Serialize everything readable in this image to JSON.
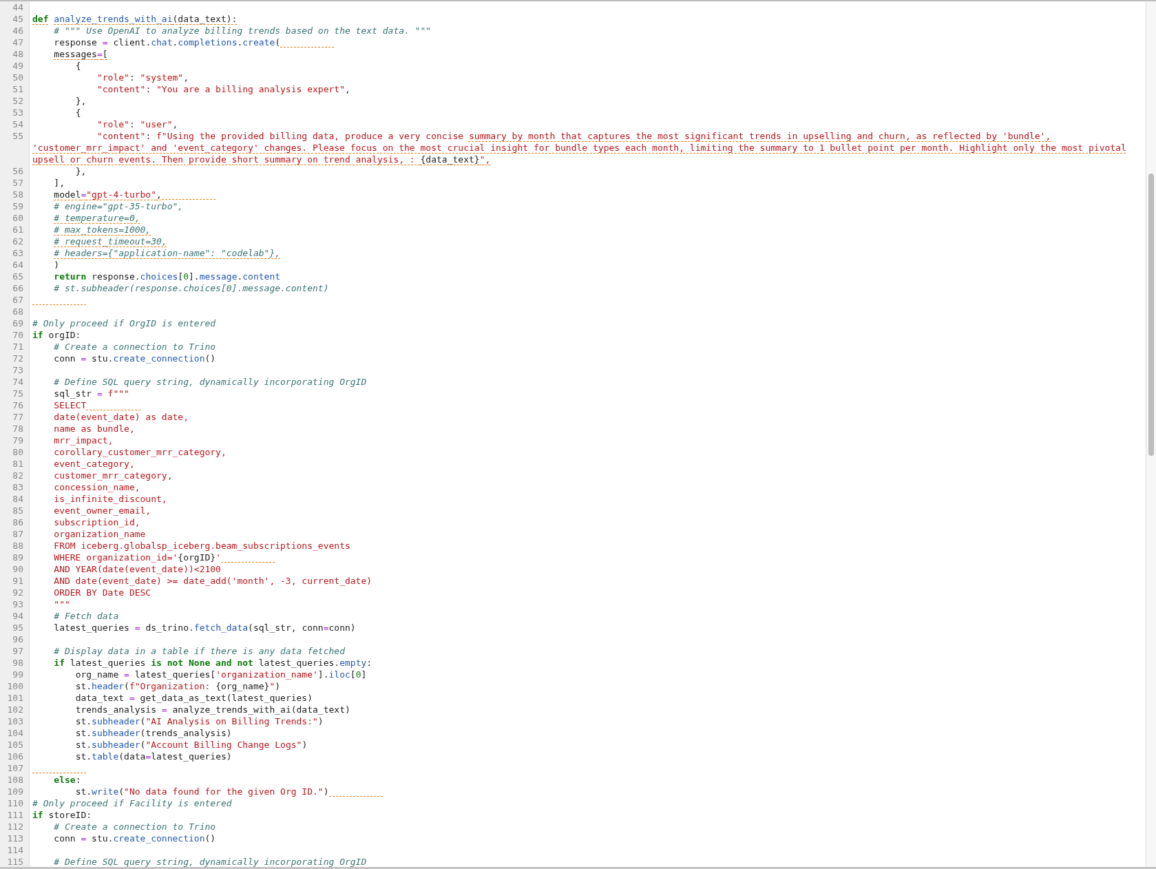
{
  "editor": {
    "lines": [
      {
        "number": "44"
      },
      {
        "number": "45",
        "tokens": [
          {
            "kind": "k",
            "text": "def",
            "warning": true
          },
          {
            "kind": "f",
            "text": " analyze_trends_with_ai",
            "warning": true
          },
          {
            "kind": "p",
            "text": "(data_text):",
            "warning": true
          }
        ]
      },
      {
        "number": "46",
        "tokens": [
          {
            "kind": "c",
            "text": "    # \"\"\" Use OpenAI to analyze billing trends based on the text data. \"\"\""
          }
        ]
      },
      {
        "number": "47",
        "trailing_warning": true,
        "tokens": [
          {
            "kind": "p",
            "text": "    response "
          },
          {
            "kind": "o",
            "text": "="
          },
          {
            "kind": "p",
            "text": " client."
          },
          {
            "kind": "f",
            "text": "chat"
          },
          {
            "kind": "p",
            "text": "."
          },
          {
            "kind": "f",
            "text": "completions"
          },
          {
            "kind": "p",
            "text": "."
          },
          {
            "kind": "f",
            "text": "create"
          },
          {
            "kind": "p",
            "text": "("
          }
        ]
      },
      {
        "number": "48",
        "tokens": [
          {
            "kind": "p",
            "text": "    messages",
            "warning": true
          },
          {
            "kind": "o",
            "text": "=",
            "warning": true
          },
          {
            "kind": "p",
            "text": "[",
            "warning": true
          }
        ]
      },
      {
        "number": "49",
        "tokens": [
          {
            "kind": "p",
            "text": "        {"
          }
        ]
      },
      {
        "number": "50",
        "tokens": [
          {
            "kind": "s",
            "text": "            \"role\""
          },
          {
            "kind": "p",
            "text": ": "
          },
          {
            "kind": "s",
            "text": "\"system\""
          },
          {
            "kind": "p",
            "text": ","
          }
        ]
      },
      {
        "number": "51",
        "tokens": [
          {
            "kind": "s",
            "text": "            \"content\""
          },
          {
            "kind": "p",
            "text": ": "
          },
          {
            "kind": "s",
            "text": "\"You are a billing analysis expert\""
          },
          {
            "kind": "p",
            "text": ","
          }
        ]
      },
      {
        "number": "52",
        "tokens": [
          {
            "kind": "p",
            "text": "        },"
          }
        ]
      },
      {
        "number": "53",
        "tokens": [
          {
            "kind": "p",
            "text": "        {"
          }
        ]
      },
      {
        "number": "54",
        "tokens": [
          {
            "kind": "s",
            "text": "            \"role\""
          },
          {
            "kind": "p",
            "text": ": "
          },
          {
            "kind": "s",
            "text": "\"user\""
          },
          {
            "kind": "p",
            "text": ","
          }
        ]
      },
      {
        "number": "55",
        "tokens": [
          {
            "kind": "s",
            "text": "            \"content\""
          },
          {
            "kind": "p",
            "text": ": "
          },
          {
            "kind": "s",
            "text": "f\"Using the provided billing data, produce a very concise"
          },
          {
            "kind": "s",
            "text": " summary by month that captures the most significant trends in upselling and churn, as reflected by 'bundle',",
            "warning": true
          }
        ],
        "continuation": [
          [
            {
              "kind": "s",
              "text": "'customer_mrr_impact' and 'event_category' changes. Please focus on the most crucial insight for bundle types each month, limiting the summary to 1 bullet point per month. Highlight only the most pivotal",
              "warning": true
            }
          ],
          [
            {
              "kind": "s",
              "text": "upsell or churn events. Then provide short summary on trend analysis, : ",
              "warning": true
            },
            {
              "kind": "p",
              "text": "{data_text}",
              "warning": true
            },
            {
              "kind": "s",
              "text": "\",",
              "warning": true
            }
          ]
        ]
      },
      {
        "number": "56",
        "tokens": [
          {
            "kind": "p",
            "text": "        },"
          }
        ]
      },
      {
        "number": "57",
        "tokens": [
          {
            "kind": "p",
            "text": "    ],"
          }
        ]
      },
      {
        "number": "58",
        "trailing_warning": true,
        "tokens": [
          {
            "kind": "p",
            "text": "    model",
            "warning": true
          },
          {
            "kind": "o",
            "text": "=",
            "warning": true
          },
          {
            "kind": "s",
            "text": "\"gpt-4-turbo\"",
            "warning": true
          },
          {
            "kind": "p",
            "text": ",",
            "warning": true
          }
        ]
      },
      {
        "number": "59",
        "tokens": [
          {
            "kind": "c",
            "text": "    # engine=\"gpt-35-turbo\","
          }
        ]
      },
      {
        "number": "60",
        "tokens": [
          {
            "kind": "c",
            "text": "    # temperature=0,",
            "warning": true
          }
        ]
      },
      {
        "number": "61",
        "tokens": [
          {
            "kind": "c",
            "text": "    # max_tokens=1000,",
            "warning": true
          }
        ]
      },
      {
        "number": "62",
        "tokens": [
          {
            "kind": "c",
            "text": "    # request_timeout=30,",
            "warning": true
          }
        ]
      },
      {
        "number": "63",
        "tokens": [
          {
            "kind": "c",
            "text": "    # headers={\"application-name\": \"codelab\"},",
            "warning": true
          }
        ]
      },
      {
        "number": "64",
        "tokens": [
          {
            "kind": "p",
            "text": "    )"
          }
        ]
      },
      {
        "number": "65",
        "tokens": [
          {
            "kind": "k",
            "text": "    return"
          },
          {
            "kind": "p",
            "text": " response."
          },
          {
            "kind": "f",
            "text": "choices"
          },
          {
            "kind": "p",
            "text": "["
          },
          {
            "kind": "n",
            "text": "0"
          },
          {
            "kind": "p",
            "text": "]."
          },
          {
            "kind": "f",
            "text": "message"
          },
          {
            "kind": "p",
            "text": "."
          },
          {
            "kind": "f",
            "text": "content"
          }
        ]
      },
      {
        "number": "66",
        "tokens": [
          {
            "kind": "c",
            "text": "    # st.subheader(response.choices[0].message.content)"
          }
        ]
      },
      {
        "number": "67",
        "trailing_warning": true
      },
      {
        "number": "68"
      },
      {
        "number": "69",
        "tokens": [
          {
            "kind": "c",
            "text": "# Only proceed if OrgID is entered"
          }
        ]
      },
      {
        "number": "70",
        "tokens": [
          {
            "kind": "k",
            "text": "if"
          },
          {
            "kind": "p",
            "text": " orgID:"
          }
        ]
      },
      {
        "number": "71",
        "tokens": [
          {
            "kind": "c",
            "text": "    # Create a connection to Trino"
          }
        ]
      },
      {
        "number": "72",
        "tokens": [
          {
            "kind": "p",
            "text": "    conn "
          },
          {
            "kind": "o",
            "text": "="
          },
          {
            "kind": "p",
            "text": " stu."
          },
          {
            "kind": "f",
            "text": "create_connection"
          },
          {
            "kind": "p",
            "text": "()"
          }
        ]
      },
      {
        "number": "73"
      },
      {
        "number": "74",
        "tokens": [
          {
            "kind": "c",
            "text": "    # Define SQL query string, dynamically incorporating OrgID"
          }
        ]
      },
      {
        "number": "75",
        "tokens": [
          {
            "kind": "p",
            "text": "    sql_str "
          },
          {
            "kind": "o",
            "text": "="
          },
          {
            "kind": "s",
            "text": " f\"\"\""
          }
        ]
      },
      {
        "number": "76",
        "trailing_warning": true,
        "tokens": [
          {
            "kind": "s",
            "text": "    SELECT"
          }
        ]
      },
      {
        "number": "77",
        "tokens": [
          {
            "kind": "s",
            "text": "    date(event_date) as date,"
          }
        ]
      },
      {
        "number": "78",
        "tokens": [
          {
            "kind": "s",
            "text": "    name as bundle,"
          }
        ]
      },
      {
        "number": "79",
        "tokens": [
          {
            "kind": "s",
            "text": "    mrr_impact,"
          }
        ]
      },
      {
        "number": "80",
        "tokens": [
          {
            "kind": "s",
            "text": "    corollary_customer_mrr_category,"
          }
        ]
      },
      {
        "number": "81",
        "tokens": [
          {
            "kind": "s",
            "text": "    event_category,"
          }
        ]
      },
      {
        "number": "82",
        "tokens": [
          {
            "kind": "s",
            "text": "    customer_mrr_category,"
          }
        ]
      },
      {
        "number": "83",
        "tokens": [
          {
            "kind": "s",
            "text": "    concession_name,"
          }
        ]
      },
      {
        "number": "84",
        "tokens": [
          {
            "kind": "s",
            "text": "    is_infinite_discount,"
          }
        ]
      },
      {
        "number": "85",
        "tokens": [
          {
            "kind": "s",
            "text": "    event_owner_email,"
          }
        ]
      },
      {
        "number": "86",
        "tokens": [
          {
            "kind": "s",
            "text": "    subscription_id,"
          }
        ]
      },
      {
        "number": "87",
        "tokens": [
          {
            "kind": "s",
            "text": "    organization_name"
          }
        ]
      },
      {
        "number": "88",
        "tokens": [
          {
            "kind": "s",
            "text": "    FROM iceberg.globalsp_iceberg.beam_subscriptions_events"
          }
        ]
      },
      {
        "number": "89",
        "trailing_warning": true,
        "tokens": [
          {
            "kind": "s",
            "text": "    WHERE organization_id='"
          },
          {
            "kind": "p",
            "text": "{orgID}"
          },
          {
            "kind": "s",
            "text": "'"
          }
        ]
      },
      {
        "number": "90",
        "tokens": [
          {
            "kind": "s",
            "text": "    AND YEAR(date(event_date))<2100"
          }
        ]
      },
      {
        "number": "91",
        "tokens": [
          {
            "kind": "s",
            "text": "    AND date(event_date) >= date_add('month', -3, current_date)"
          }
        ]
      },
      {
        "number": "92",
        "tokens": [
          {
            "kind": "s",
            "text": "    ORDER BY Date DESC"
          }
        ]
      },
      {
        "number": "93",
        "tokens": [
          {
            "kind": "s",
            "text": "    \"\"\""
          }
        ]
      },
      {
        "number": "94",
        "tokens": [
          {
            "kind": "c",
            "text": "    # Fetch data"
          }
        ]
      },
      {
        "number": "95",
        "tokens": [
          {
            "kind": "p",
            "text": "    latest_queries "
          },
          {
            "kind": "o",
            "text": "="
          },
          {
            "kind": "p",
            "text": " ds_trino."
          },
          {
            "kind": "f",
            "text": "fetch_data"
          },
          {
            "kind": "p",
            "text": "(sql_str, conn"
          },
          {
            "kind": "o",
            "text": "="
          },
          {
            "kind": "p",
            "text": "conn)"
          }
        ]
      },
      {
        "number": "96"
      },
      {
        "number": "97",
        "tokens": [
          {
            "kind": "c",
            "text": "    # Display data in a table if there is any data fetched"
          }
        ]
      },
      {
        "number": "98",
        "tokens": [
          {
            "kind": "k",
            "text": "    if"
          },
          {
            "kind": "p",
            "text": " latest_queries "
          },
          {
            "kind": "k",
            "text": "is not None and not"
          },
          {
            "kind": "p",
            "text": " latest_queries."
          },
          {
            "kind": "f",
            "text": "empty"
          },
          {
            "kind": "p",
            "text": ":"
          }
        ]
      },
      {
        "number": "99",
        "tokens": [
          {
            "kind": "p",
            "text": "        org_name "
          },
          {
            "kind": "o",
            "text": "="
          },
          {
            "kind": "p",
            "text": " latest_queries["
          },
          {
            "kind": "s",
            "text": "'organization_name'"
          },
          {
            "kind": "p",
            "text": "]."
          },
          {
            "kind": "f",
            "text": "iloc"
          },
          {
            "kind": "p",
            "text": "["
          },
          {
            "kind": "n",
            "text": "0"
          },
          {
            "kind": "p",
            "text": "]"
          }
        ]
      },
      {
        "number": "100",
        "tokens": [
          {
            "kind": "p",
            "text": "        st."
          },
          {
            "kind": "f",
            "text": "header"
          },
          {
            "kind": "p",
            "text": "("
          },
          {
            "kind": "s",
            "text": "f\"Organization: "
          },
          {
            "kind": "p",
            "text": "{org_name}"
          },
          {
            "kind": "s",
            "text": "\""
          },
          {
            "kind": "p",
            "text": ")"
          }
        ]
      },
      {
        "number": "101",
        "tokens": [
          {
            "kind": "p",
            "text": "        data_text "
          },
          {
            "kind": "o",
            "text": "="
          },
          {
            "kind": "p",
            "text": " get_data_as_text(latest_queries)"
          }
        ]
      },
      {
        "number": "102",
        "tokens": [
          {
            "kind": "p",
            "text": "        trends_analysis "
          },
          {
            "kind": "o",
            "text": "="
          },
          {
            "kind": "p",
            "text": " analyze_trends_with_ai(data_text)"
          }
        ]
      },
      {
        "number": "103",
        "tokens": [
          {
            "kind": "p",
            "text": "        st."
          },
          {
            "kind": "f",
            "text": "subheader"
          },
          {
            "kind": "p",
            "text": "("
          },
          {
            "kind": "s",
            "text": "\"AI Analysis on Billing Trends:\""
          },
          {
            "kind": "p",
            "text": ")"
          }
        ]
      },
      {
        "number": "104",
        "tokens": [
          {
            "kind": "p",
            "text": "        st."
          },
          {
            "kind": "f",
            "text": "subheader"
          },
          {
            "kind": "p",
            "text": "(trends_analysis)"
          }
        ]
      },
      {
        "number": "105",
        "tokens": [
          {
            "kind": "p",
            "text": "        st."
          },
          {
            "kind": "f",
            "text": "subheader"
          },
          {
            "kind": "p",
            "text": "("
          },
          {
            "kind": "s",
            "text": "\"Account Billing Change Logs\""
          },
          {
            "kind": "p",
            "text": ")"
          }
        ]
      },
      {
        "number": "106",
        "tokens": [
          {
            "kind": "p",
            "text": "        st."
          },
          {
            "kind": "f",
            "text": "table"
          },
          {
            "kind": "p",
            "text": "(data"
          },
          {
            "kind": "o",
            "text": "="
          },
          {
            "kind": "p",
            "text": "latest_queries)"
          }
        ]
      },
      {
        "number": "107",
        "trailing_warning": true
      },
      {
        "number": "108",
        "tokens": [
          {
            "kind": "k",
            "text": "    else"
          },
          {
            "kind": "p",
            "text": ":"
          }
        ]
      },
      {
        "number": "109",
        "trailing_warning": true,
        "tokens": [
          {
            "kind": "p",
            "text": "        st."
          },
          {
            "kind": "f",
            "text": "write"
          },
          {
            "kind": "p",
            "text": "("
          },
          {
            "kind": "s",
            "text": "\"No data found for the given Org ID.\""
          },
          {
            "kind": "p",
            "text": ")"
          }
        ]
      },
      {
        "number": "110",
        "tokens": [
          {
            "kind": "c",
            "text": "# Only proceed if Facility is entered"
          }
        ]
      },
      {
        "number": "111",
        "tokens": [
          {
            "kind": "k",
            "text": "if"
          },
          {
            "kind": "p",
            "text": " storeID:"
          }
        ]
      },
      {
        "number": "112",
        "tokens": [
          {
            "kind": "c",
            "text": "    # Create a connection to Trino"
          }
        ]
      },
      {
        "number": "113",
        "tokens": [
          {
            "kind": "p",
            "text": "    conn "
          },
          {
            "kind": "o",
            "text": "="
          },
          {
            "kind": "p",
            "text": " stu."
          },
          {
            "kind": "f",
            "text": "create_connection"
          },
          {
            "kind": "p",
            "text": "()"
          }
        ]
      },
      {
        "number": "114"
      },
      {
        "number": "115",
        "tokens": [
          {
            "kind": "c",
            "text": "    # Define SQL query string, dynamically incorporating OrgID"
          }
        ]
      }
    ]
  }
}
